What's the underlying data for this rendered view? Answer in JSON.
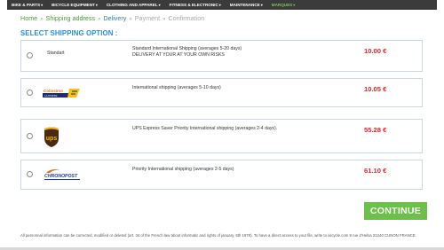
{
  "nav": {
    "items": [
      {
        "label": "BIKE & PARTS"
      },
      {
        "label": "BICYCLE EQUIPMENT"
      },
      {
        "label": "CLOTHING AND APPAREL"
      },
      {
        "label": "FITNESS & ELECTRONIC"
      },
      {
        "label": "MAINTENANCE"
      },
      {
        "label": "MARQUES"
      }
    ]
  },
  "breadcrumb": {
    "home": "Home",
    "shipping": "Shipping address",
    "delivery": "Delivery",
    "payment": "Payment",
    "confirmation": "Confirmation",
    "separator": "»"
  },
  "section_title": "SELECT SHIPPING OPTION :",
  "options": [
    {
      "carrier": "Standart",
      "desc_line1": "Standard International Shipping (averages 5-20 days)",
      "desc_line2": "DELIVERY AT YOUR AT YOUR OWN RISKS",
      "price": "10.00 €"
    },
    {
      "carrier_logo": "Colissimo",
      "carrier_logo_sub": "LA POSTE",
      "desc_line1": "International shipping (averages 5-10 days)",
      "price": "10.05 €"
    },
    {
      "carrier_logo": "ups",
      "desc_line1": "UPS Express Saver Priority International shipping (averages 2-4 days).",
      "price": "55.28 €"
    },
    {
      "carrier_logo": "CHRONOPOST",
      "desc_line1": "Priority International shipping (averages 2-5 days)",
      "price": "61.10 €"
    }
  ],
  "continue_label": "CONTINUE",
  "footer_text": "All personnal information can be corrected, modified or deleted (art. 34 of the French law about informatic and rights of january, 6th 1978). To have a direct access to your file, write to ixicycle.com 9 rue d'Helsa 21240 CUNON FRANCE.",
  "colors": {
    "accent": "#2a8fd8",
    "price": "#e0242b",
    "button": "#6cc04a",
    "nav_bg": "#3b3b3b"
  }
}
